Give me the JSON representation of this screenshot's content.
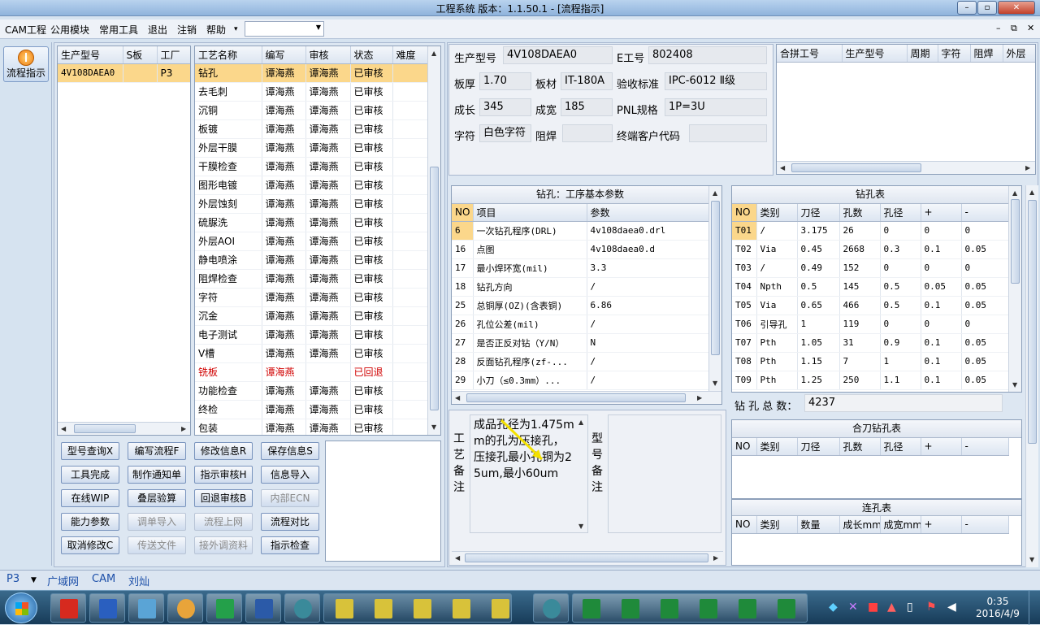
{
  "window": {
    "title": "工程系统  版本：1.1.50.1 - [流程指示]"
  },
  "menu": [
    "CAM工程",
    "公用模块",
    "常用工具",
    "退出",
    "注销",
    "帮助"
  ],
  "menu_help_arrow": "▾",
  "left": {
    "flow_button": "流程指示"
  },
  "product_grid": {
    "headers": [
      "生产型号",
      "S板",
      "工厂"
    ],
    "rows": [
      [
        "4V108DAEA0",
        "",
        "P3"
      ]
    ]
  },
  "process_grid": {
    "headers": [
      "工艺名称",
      "编写",
      "审核",
      "状态",
      "难度"
    ],
    "rows": [
      [
        "钻孔",
        "谭海燕",
        "谭海燕",
        "已审核",
        ""
      ],
      [
        "去毛刺",
        "谭海燕",
        "谭海燕",
        "已审核",
        ""
      ],
      [
        "沉铜",
        "谭海燕",
        "谭海燕",
        "已审核",
        ""
      ],
      [
        "板镀",
        "谭海燕",
        "谭海燕",
        "已审核",
        ""
      ],
      [
        "外层干膜",
        "谭海燕",
        "谭海燕",
        "已审核",
        ""
      ],
      [
        "干膜检查",
        "谭海燕",
        "谭海燕",
        "已审核",
        ""
      ],
      [
        "图形电镀",
        "谭海燕",
        "谭海燕",
        "已审核",
        ""
      ],
      [
        "外层蚀刻",
        "谭海燕",
        "谭海燕",
        "已审核",
        ""
      ],
      [
        "硫脲洗",
        "谭海燕",
        "谭海燕",
        "已审核",
        ""
      ],
      [
        "外层AOI",
        "谭海燕",
        "谭海燕",
        "已审核",
        ""
      ],
      [
        "静电喷涂",
        "谭海燕",
        "谭海燕",
        "已审核",
        ""
      ],
      [
        "阻焊检查",
        "谭海燕",
        "谭海燕",
        "已审核",
        ""
      ],
      [
        "字符",
        "谭海燕",
        "谭海燕",
        "已审核",
        ""
      ],
      [
        "沉金",
        "谭海燕",
        "谭海燕",
        "已审核",
        ""
      ],
      [
        "电子测试",
        "谭海燕",
        "谭海燕",
        "已审核",
        ""
      ],
      [
        "V槽",
        "谭海燕",
        "谭海燕",
        "已审核",
        ""
      ],
      [
        "铣板",
        "谭海燕",
        "",
        "已回退",
        ""
      ],
      [
        "功能检查",
        "谭海燕",
        "谭海燕",
        "已审核",
        ""
      ],
      [
        "终检",
        "谭海燕",
        "谭海燕",
        "已审核",
        ""
      ],
      [
        "包装",
        "谭海燕",
        "谭海燕",
        "已审核",
        ""
      ]
    ]
  },
  "buttons": [
    [
      "型号查询X",
      "编写流程F",
      "修改信息R",
      "保存信息S"
    ],
    [
      "工具完成",
      "制作通知单",
      "指示审核H",
      "信息导入"
    ],
    [
      "在线WIP",
      "叠层验算",
      "回退审核B",
      "内部ECN"
    ],
    [
      "能力参数",
      "调单导入",
      "流程上网",
      "流程对比"
    ],
    [
      "取消修改C",
      "传送文件",
      "接外调资料",
      "指示检查"
    ]
  ],
  "disabled_buttons": [
    "内部ECN",
    "调单导入",
    "流程上网",
    "传送文件",
    "接外调资料"
  ],
  "info": {
    "product_model_label": "生产型号",
    "product_model": "4V108DAEA0",
    "e_no_label": "E工号",
    "e_no": "802408",
    "thickness_label": "板厚",
    "thickness": "1.70",
    "material_label": "板材",
    "material": "IT-180A",
    "standard_label": "验收标准",
    "standard": "IPC-6012 Ⅱ级",
    "length_label": "成长",
    "length": "345",
    "width_label": "成宽",
    "width": "185",
    "pnl_label": "PNL规格",
    "pnl": "1P=3U",
    "char_label": "字符",
    "char": "白色字符",
    "mask_label": "阻焊",
    "mask": "",
    "customer_label": "终端客户代码",
    "customer": ""
  },
  "merge_grid": {
    "headers": [
      "合拼工号",
      "生产型号",
      "周期",
      "字符",
      "阻焊",
      "外层"
    ]
  },
  "drill_params": {
    "caption": "钻孔：工序基本参数",
    "headers": [
      "NO",
      "项目",
      "参数"
    ],
    "rows": [
      [
        "6",
        "一次钻孔程序(DRL)",
        "4v108daea0.drl"
      ],
      [
        "16",
        "点图",
        "4v108daea0.d"
      ],
      [
        "17",
        "最小焊环宽(mil)",
        "3.3"
      ],
      [
        "18",
        "钻孔方向",
        "/"
      ],
      [
        "25",
        "总铜厚(OZ)(含表铜)",
        "6.86"
      ],
      [
        "26",
        "孔位公差(mil)",
        "/"
      ],
      [
        "27",
        "是否正反对钻（Y/N）",
        "N"
      ],
      [
        "28",
        "反面钻孔程序(zf-...",
        "/"
      ],
      [
        "29",
        "小刀（≤0.3mm）...",
        "/"
      ]
    ]
  },
  "drill_table": {
    "caption": "钻孔表",
    "headers": [
      "NO",
      "类别",
      "刀径",
      "孔数",
      "孔径",
      "+",
      "-"
    ],
    "rows": [
      [
        "T01",
        "/",
        "3.175",
        "26",
        "0",
        "0",
        "0"
      ],
      [
        "T02",
        "Via",
        "0.45",
        "2668",
        "0.3",
        "0.1",
        "0.05"
      ],
      [
        "T03",
        "/",
        "0.49",
        "152",
        "0",
        "0",
        "0"
      ],
      [
        "T04",
        "Npth",
        "0.5",
        "145",
        "0.5",
        "0.05",
        "0.05"
      ],
      [
        "T05",
        "Via",
        "0.65",
        "466",
        "0.5",
        "0.1",
        "0.05"
      ],
      [
        "T06",
        "引导孔",
        "1",
        "119",
        "0",
        "0",
        "0"
      ],
      [
        "T07",
        "Pth",
        "1.05",
        "31",
        "0.9",
        "0.1",
        "0.05"
      ],
      [
        "T08",
        "Pth",
        "1.15",
        "7",
        "1",
        "0.1",
        "0.05"
      ],
      [
        "T09",
        "Pth",
        "1.25",
        "250",
        "1.1",
        "0.1",
        "0.05"
      ]
    ],
    "total_label": "钻 孔 总 数：",
    "total": "4237"
  },
  "combo_drill": {
    "caption": "合刀钻孔表",
    "headers": [
      "NO",
      "类别",
      "刀径",
      "孔数",
      "孔径",
      "+",
      "-"
    ]
  },
  "slot_table": {
    "caption": "连孔表",
    "headers": [
      "NO",
      "类别",
      "数量",
      "成长mm",
      "成宽mm",
      "+",
      "-"
    ]
  },
  "process_note": {
    "label": [
      "工",
      "艺",
      "备",
      "注"
    ],
    "text": "成品孔径为1.475mm的孔为压接孔，压接孔最小孔铜为25um,最小60um"
  },
  "model_note": {
    "label": [
      "型",
      "号",
      "备",
      "注"
    ]
  },
  "status": {
    "factory": "P3",
    "network": "广域网",
    "module": "CAM",
    "user": "刘灿"
  },
  "clock": {
    "time": "0:35",
    "date": "2016/4/9"
  },
  "colors": {
    "selected_row": "#fbd78b",
    "returned_status": "#d00000"
  }
}
